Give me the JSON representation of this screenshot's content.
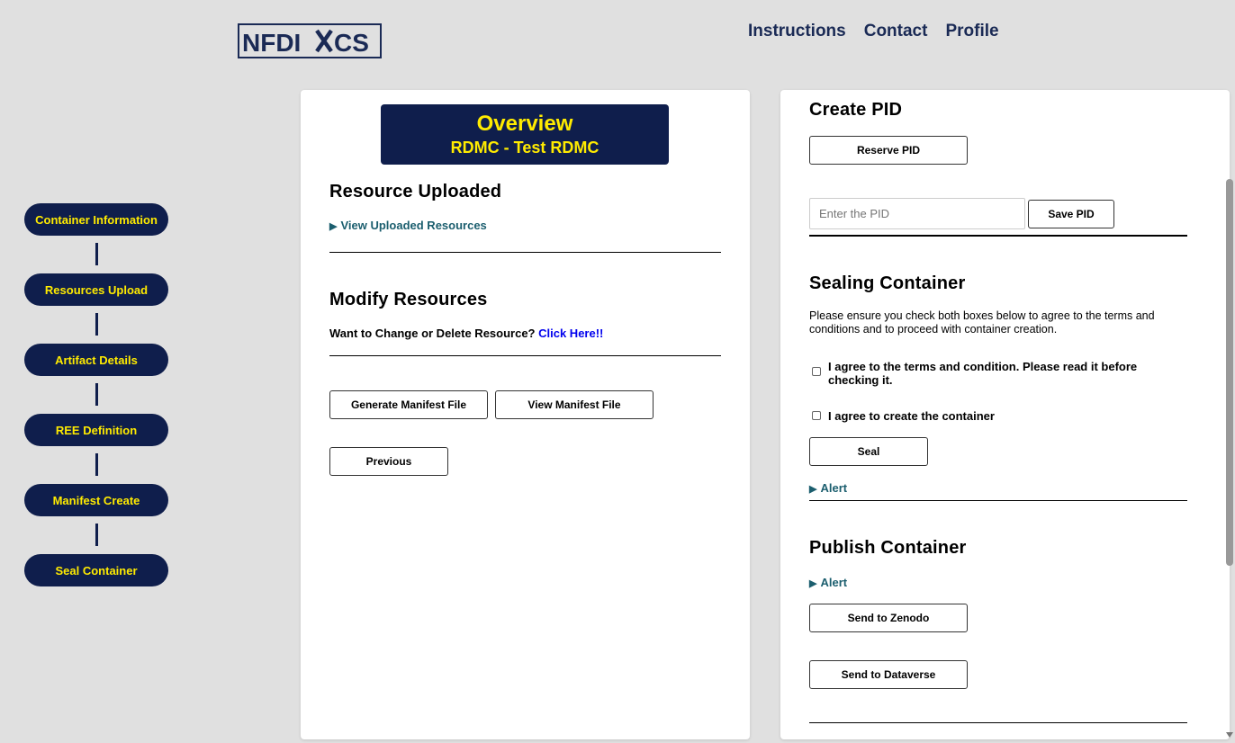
{
  "brand": {
    "logo_text_left": "NFDI",
    "logo_text_right": "CS"
  },
  "topnav": [
    {
      "label": "Instructions"
    },
    {
      "label": "Contact"
    },
    {
      "label": "Profile"
    }
  ],
  "steps": [
    {
      "label": "Container Information"
    },
    {
      "label": "Resources Upload"
    },
    {
      "label": "Artifact Details"
    },
    {
      "label": "REE Definition"
    },
    {
      "label": "Manifest Create"
    },
    {
      "label": "Seal Container"
    }
  ],
  "left_panel": {
    "overview_title": "Overview",
    "overview_subtitle": "RDMC - Test RDMC",
    "resource_uploaded_heading": "Resource Uploaded",
    "view_uploaded_label": "View Uploaded Resources",
    "modify_heading": "Modify Resources",
    "modify_text": "Want to Change or Delete Resource?",
    "modify_link": "Click Here!!",
    "generate_manifest_label": "Generate Manifest File",
    "view_manifest_label": "View Manifest File",
    "previous_label": "Previous"
  },
  "right_panel": {
    "create_pid_heading": "Create PID",
    "reserve_pid_label": "Reserve PID",
    "pid_placeholder": "Enter the PID",
    "save_pid_label": "Save PID",
    "sealing_heading": "Sealing Container",
    "sealing_text": "Please ensure you check both boxes below to agree to the terms and conditions and to proceed with container creation.",
    "agree_terms_label": "I agree to the terms and condition. Please read it before checking it.",
    "agree_create_label": "I agree to create the container",
    "seal_label": "Seal",
    "alert_label_1": "Alert",
    "publish_heading": "Publish Container",
    "alert_label_2": "Alert",
    "zenodo_label": "Send to Zenodo",
    "dataverse_label": "Send to Dataverse"
  },
  "colors": {
    "navy": "#0f1e4c",
    "yellow": "#ffeb00",
    "teal": "#1b5e6e",
    "link": "#0000ee"
  }
}
